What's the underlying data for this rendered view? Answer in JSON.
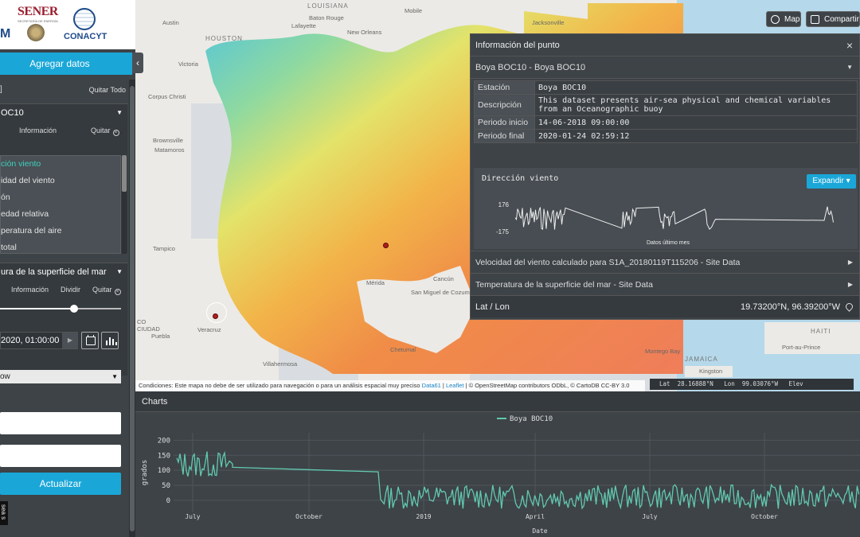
{
  "logos": {
    "sener": "SENER",
    "sener_sub": "SECRETARÍA DE ENERGÍA",
    "conacyt": "CONACYT",
    "m": "M"
  },
  "sidebar": {
    "add_data": "Agregar datos",
    "collapse_icon": "‹",
    "layers_bracket": "]",
    "clear_all": "Quitar Todo",
    "layer1": {
      "title": "OC10",
      "info": "Información",
      "remove": "Quitar",
      "variables": [
        "ción viento",
        "idad del viento",
        "ón",
        "edad relativa",
        "peratura del aire",
        "total"
      ],
      "selected_index": 0
    },
    "layer2": {
      "title": "ura de la superficie del mar",
      "info": "Información",
      "split": "Dividir",
      "remove": "Quitar",
      "opacity": 0.61,
      "date": "2020, 01:00:00"
    },
    "style_value": "ow",
    "update_button": "Actualizar",
    "legend_text": "sea s"
  },
  "map": {
    "buttons": {
      "map": "Map",
      "share": "Compartir"
    },
    "labels": {
      "louisiana": "LOUISIANA",
      "houston": "HOUSTON",
      "austin": "Austin",
      "victoria": "Victoria",
      "baton_rouge": "Baton Rouge",
      "new_orleans": "New Orleans",
      "mobile": "Mobile",
      "jacksonville": "Jacksonville",
      "lafayette": "Lafayette",
      "corpus": "Corpus Christi",
      "brownsville": "Brownsville",
      "matamoros": "Matamoros",
      "tampico": "Tampico",
      "veracruz": "Veracruz",
      "puebla": "Puebla",
      "villahermosa": "Villahermosa",
      "merida": "Mérida",
      "cancun": "Cancún",
      "san_miguel": "San Miguel de Cozumel",
      "chetumal": "Chetumal",
      "haiti": "HAITI",
      "port_au_prince": "Port-au-Prince",
      "jamaica": "JAMAICA",
      "montego": "Montego Bay",
      "kingston": "Kingston",
      "co": "CO",
      "ciudad": "CIUDAD"
    },
    "attribution": {
      "text": "Condiciones: Este mapa no debe de ser utilizado para navegación o para un análisis espacial muy preciso",
      "data61": "Data61",
      "sep1": " | ",
      "leaflet": "Leaflet",
      "rest": " | © OpenStreetMap contributors ODbL, © CartoDB CC-BY 3.0"
    },
    "coords": "Lat  28.16888°N   Lon  99.03076°W   Elev"
  },
  "info_panel": {
    "title": "Información del punto",
    "close_icon": "×",
    "station_select": "Boya BOC10 - Boya BOC10",
    "rows": [
      {
        "k": "Estación",
        "v": "Boya BOC10"
      },
      {
        "k": "Descripción",
        "v": "This dataset presents air-sea physical and chemical variables from an Oceanographic buoy"
      },
      {
        "k": "Periodo inicio",
        "v": "14-06-2018 09:00:00"
      },
      {
        "k": "Periodo final",
        "v": "2020-01-24 02:59:12"
      }
    ],
    "mini_chart": {
      "title": "Dirección viento",
      "expand": "Expandir ▾",
      "y_top": "176",
      "y_bottom": "-175",
      "xlabel": "Datos último mes"
    },
    "links": [
      "Velocidad del viento calculado para S1A_20180119T115206 - Site Data",
      "Temperatura de la superficie del mar - Site Data"
    ],
    "latlon_label": "Lat / Lon",
    "latlon_value": "19.73200°N, 96.39200°W"
  },
  "charts": {
    "header": "Charts",
    "line_color": "#62c9b0"
  },
  "chart_data": {
    "type": "line",
    "title": "",
    "series": [
      {
        "name": "Boya BOC10"
      }
    ],
    "ylabel": "grados",
    "xlabel": "Date",
    "ylim": [
      -40,
      225
    ],
    "yticks": [
      200,
      150,
      100,
      50,
      0
    ],
    "xticks": [
      "July",
      "October",
      "2019",
      "April",
      "July",
      "October"
    ],
    "grid": true,
    "legend": "top-center"
  }
}
